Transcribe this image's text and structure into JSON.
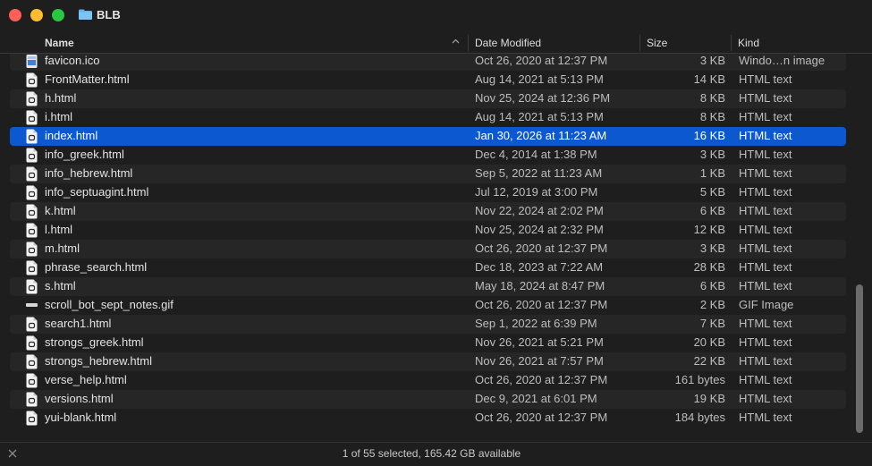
{
  "window": {
    "title": "BLB"
  },
  "columns": {
    "name": "Name",
    "date": "Date Modified",
    "size": "Size",
    "kind": "Kind"
  },
  "files": [
    {
      "name": "favicon.ico",
      "date": "Oct 26, 2020 at 12:37 PM",
      "size": "3 KB",
      "kind": "Windo…n image",
      "icon": "ico-image-icon"
    },
    {
      "name": "FrontMatter.html",
      "date": "Aug 14, 2021 at 5:13 PM",
      "size": "14 KB",
      "kind": "HTML text",
      "icon": "html-file-icon"
    },
    {
      "name": "h.html",
      "date": "Nov 25, 2024 at 12:36 PM",
      "size": "8 KB",
      "kind": "HTML text",
      "icon": "html-file-icon"
    },
    {
      "name": "i.html",
      "date": "Aug 14, 2021 at 5:13 PM",
      "size": "8 KB",
      "kind": "HTML text",
      "icon": "html-file-icon"
    },
    {
      "name": "index.html",
      "date": "Jan 30, 2026 at 11:23 AM",
      "size": "16 KB",
      "kind": "HTML text",
      "icon": "html-file-icon",
      "selected": true
    },
    {
      "name": "info_greek.html",
      "date": "Dec 4, 2014 at 1:38 PM",
      "size": "3 KB",
      "kind": "HTML text",
      "icon": "html-file-icon"
    },
    {
      "name": "info_hebrew.html",
      "date": "Sep 5, 2022 at 11:23 AM",
      "size": "1 KB",
      "kind": "HTML text",
      "icon": "html-file-icon"
    },
    {
      "name": "info_septuagint.html",
      "date": "Jul 12, 2019 at 3:00 PM",
      "size": "5 KB",
      "kind": "HTML text",
      "icon": "html-file-icon"
    },
    {
      "name": "k.html",
      "date": "Nov 22, 2024 at 2:02 PM",
      "size": "6 KB",
      "kind": "HTML text",
      "icon": "html-file-icon"
    },
    {
      "name": "l.html",
      "date": "Nov 25, 2024 at 2:32 PM",
      "size": "12 KB",
      "kind": "HTML text",
      "icon": "html-file-icon"
    },
    {
      "name": "m.html",
      "date": "Oct 26, 2020 at 12:37 PM",
      "size": "3 KB",
      "kind": "HTML text",
      "icon": "html-file-icon"
    },
    {
      "name": "phrase_search.html",
      "date": "Dec 18, 2023 at 7:22 AM",
      "size": "28 KB",
      "kind": "HTML text",
      "icon": "html-file-icon"
    },
    {
      "name": "s.html",
      "date": "May 18, 2024 at 8:47 PM",
      "size": "6 KB",
      "kind": "HTML text",
      "icon": "html-file-icon"
    },
    {
      "name": "scroll_bot_sept_notes.gif",
      "date": "Oct 26, 2020 at 12:37 PM",
      "size": "2 KB",
      "kind": "GIF Image",
      "icon": "gif-image-icon"
    },
    {
      "name": "search1.html",
      "date": "Sep 1, 2022 at 6:39 PM",
      "size": "7 KB",
      "kind": "HTML text",
      "icon": "html-file-icon"
    },
    {
      "name": "strongs_greek.html",
      "date": "Nov 26, 2021 at 5:21 PM",
      "size": "20 KB",
      "kind": "HTML text",
      "icon": "html-file-icon"
    },
    {
      "name": "strongs_hebrew.html",
      "date": "Nov 26, 2021 at 7:57 PM",
      "size": "22 KB",
      "kind": "HTML text",
      "icon": "html-file-icon"
    },
    {
      "name": "verse_help.html",
      "date": "Oct 26, 2020 at 12:37 PM",
      "size": "161 bytes",
      "kind": "HTML text",
      "icon": "html-file-icon"
    },
    {
      "name": "versions.html",
      "date": "Dec 9, 2021 at 6:01 PM",
      "size": "19 KB",
      "kind": "HTML text",
      "icon": "html-file-icon"
    },
    {
      "name": "yui-blank.html",
      "date": "Oct 26, 2020 at 12:37 PM",
      "size": "184 bytes",
      "kind": "HTML text",
      "icon": "html-file-icon"
    }
  ],
  "status": {
    "text": "1 of 55 selected, 165.42 GB available"
  },
  "colors": {
    "selection": "#0b58d0",
    "folder": "#5fb3f0",
    "close": "#fe5f57",
    "minimize": "#febc2e",
    "maximize": "#28c840"
  }
}
